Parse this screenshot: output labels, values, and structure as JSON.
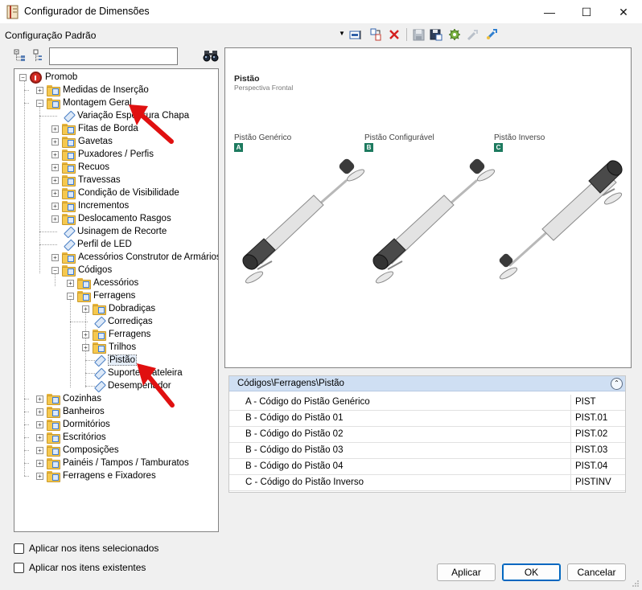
{
  "window": {
    "title": "Configurador de Dimensões",
    "minimize": "—",
    "maximize": "☐",
    "close": "✕"
  },
  "config": {
    "label": "Configuração Padrão",
    "arrow": "▼"
  },
  "search": {
    "value": ""
  },
  "tree": {
    "items": [
      {
        "label": "Promob"
      },
      {
        "label": "Medidas de Inserção"
      },
      {
        "label": "Montagem Geral"
      },
      {
        "label": "Variação Espessura Chapa"
      },
      {
        "label": "Fitas de Borda"
      },
      {
        "label": "Gavetas"
      },
      {
        "label": "Puxadores / Perfis"
      },
      {
        "label": "Recuos"
      },
      {
        "label": "Travessas"
      },
      {
        "label": "Condição de Visibilidade"
      },
      {
        "label": "Incrementos"
      },
      {
        "label": "Deslocamento Rasgos"
      },
      {
        "label": "Usinagem de Recorte"
      },
      {
        "label": "Perfil de LED"
      },
      {
        "label": "Acessórios Construtor de Armários"
      },
      {
        "label": "Códigos"
      },
      {
        "label": "Acessórios"
      },
      {
        "label": "Ferragens"
      },
      {
        "label": "Dobradiças"
      },
      {
        "label": "Corrediças"
      },
      {
        "label": "Ferragens"
      },
      {
        "label": "Trilhos"
      },
      {
        "label": "Pistão"
      },
      {
        "label": "Suporte Prateleira"
      },
      {
        "label": "Desempenador"
      },
      {
        "label": "Cozinhas"
      },
      {
        "label": "Banheiros"
      },
      {
        "label": "Dormitórios"
      },
      {
        "label": "Escritórios"
      },
      {
        "label": "Composições"
      },
      {
        "label": "Painéis / Tampos / Tamburatos"
      },
      {
        "label": "Ferragens e Fixadores"
      }
    ]
  },
  "options": {
    "apply_selected": "Aplicar nos itens selecionados",
    "apply_existing": "Aplicar nos itens existentes"
  },
  "preview": {
    "title": "Pistão",
    "subtitle": "Perspectiva Frontal",
    "variants": [
      {
        "label": "Pistão Genérico",
        "badge": "A"
      },
      {
        "label": "Pistão Configurável",
        "badge": "B"
      },
      {
        "label": "Pistão Inverso",
        "badge": "C"
      }
    ]
  },
  "properties": {
    "header": "Códigos\\Ferragens\\Pistão",
    "collapse": "⌃",
    "rows": [
      {
        "name": "A - Código do Pistão Genérico",
        "value": "PIST"
      },
      {
        "name": "B - Código do Pistão 01",
        "value": "PIST.01"
      },
      {
        "name": "B - Código do Pistão 02",
        "value": "PIST.02"
      },
      {
        "name": "B - Código do Pistão 03",
        "value": "PIST.03"
      },
      {
        "name": "B - Código do Pistão 04",
        "value": "PIST.04"
      },
      {
        "name": "C - Código do Pistão Inverso",
        "value": "PISTINV"
      }
    ]
  },
  "buttons": {
    "apply": "Aplicar",
    "ok": "OK",
    "cancel": "Cancelar"
  },
  "colors": {
    "badge": "#1d7a5f",
    "header": "#cfdff3",
    "annotation_arrow": "#e01010"
  }
}
